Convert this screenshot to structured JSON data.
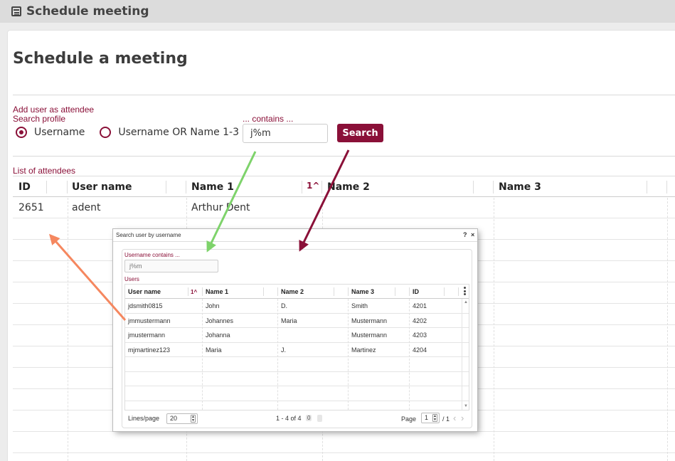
{
  "window": {
    "title": "Schedule meeting",
    "icon": "calendar-icon"
  },
  "page": {
    "title": "Schedule a meeting"
  },
  "form": {
    "section_label": "Add user as attendee",
    "profile_label": "Search profile",
    "options": [
      {
        "label": "Username",
        "checked": true
      },
      {
        "label": "Username OR Name 1-3",
        "checked": false
      }
    ],
    "contains_label": "... contains ...",
    "contains_value": "j%m",
    "search_button": "Search"
  },
  "attendees": {
    "label": "List of attendees",
    "columns": [
      "ID",
      "User name",
      "Name 1",
      "Name 2",
      "Name 3"
    ],
    "sort_indicator": "1^",
    "rows": [
      {
        "id": "2651",
        "username": "adent",
        "name1": "Arthur Dent",
        "name2": "",
        "name3": ""
      }
    ]
  },
  "dialog": {
    "title": "Search user by username",
    "help": "?",
    "close": "×",
    "filter_label": "Username contains ...",
    "filter_value": "j%m",
    "users_label": "Users",
    "columns": [
      "User name",
      "Name 1",
      "Name 2",
      "Name 3",
      "ID"
    ],
    "sort_indicator": "1^",
    "rows": [
      {
        "username": "jdsmith0815",
        "name1": "John",
        "name2": "D.",
        "name3": "Smith",
        "id": "4201"
      },
      {
        "username": "jmmustermann",
        "name1": "Johannes",
        "name2": "Maria",
        "name3": "Mustermann",
        "id": "4202"
      },
      {
        "username": "jmustermann",
        "name1": "Johanna",
        "name2": "",
        "name3": "Mustermann",
        "id": "4203"
      },
      {
        "username": "mjmartinez123",
        "name1": "Maria",
        "name2": "J.",
        "name3": "Martinez",
        "id": "4204"
      }
    ],
    "pager": {
      "lines_label": "Lines/page",
      "lines_value": "20",
      "range": "1 - 4 of 4",
      "selected_count": "0",
      "page_label": "Page",
      "page_value": "1",
      "page_total": "/ 1"
    }
  },
  "colors": {
    "accent": "#8a1038",
    "arrow_green": "#7ed36b",
    "arrow_maroon": "#8a1038",
    "arrow_orange": "#f5875f"
  }
}
